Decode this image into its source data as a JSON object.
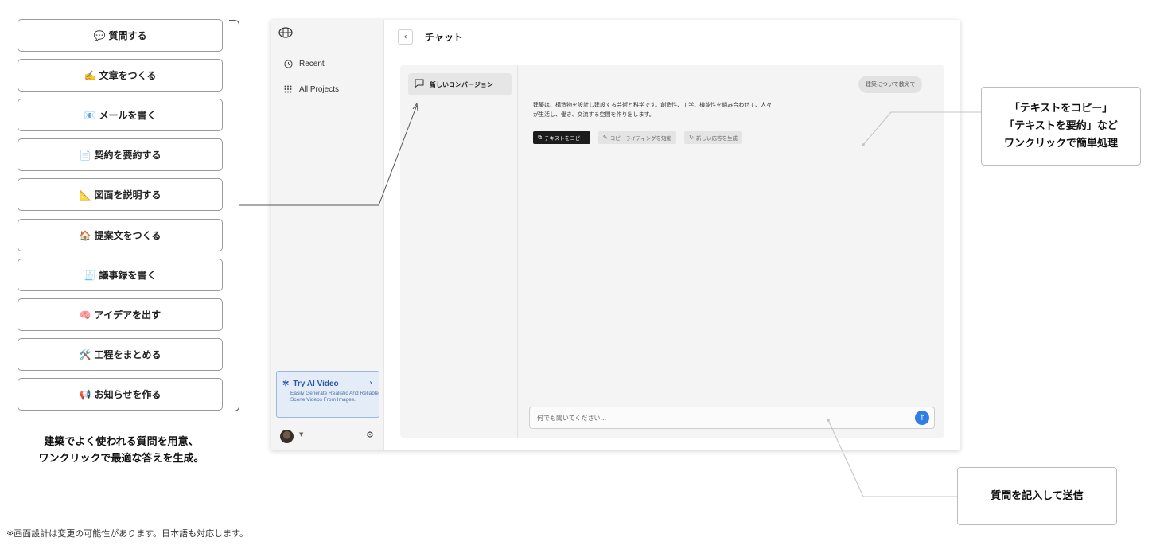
{
  "prompts": [
    {
      "emoji": "💬",
      "label": "質問する"
    },
    {
      "emoji": "✍️",
      "label": "文章をつくる"
    },
    {
      "emoji": "📧",
      "label": "メールを書く"
    },
    {
      "emoji": "📄",
      "label": "契約を要約する"
    },
    {
      "emoji": "📐",
      "label": "図面を説明する"
    },
    {
      "emoji": "🏠",
      "label": "提案文をつくる"
    },
    {
      "emoji": "🧾",
      "label": "議事録を書く"
    },
    {
      "emoji": "🧠",
      "label": "アイデアを出す"
    },
    {
      "emoji": "🛠️",
      "label": "工程をまとめる"
    },
    {
      "emoji": "📢",
      "label": "お知らせを作る"
    }
  ],
  "caption_left": {
    "line1": "建築でよく使われる質問を用意、",
    "line2": "ワンクリックで最適な答えを生成。"
  },
  "footnote": "※画面設計は変更の可能性があります。日本語も対応します。",
  "sidebar": {
    "nav": [
      {
        "icon": "clock-icon",
        "label": "Recent"
      },
      {
        "icon": "grid-icon",
        "label": "All Projects"
      }
    ],
    "promo": {
      "title": "Try AI Video",
      "description": "Easily Generate Realistic And Reliable Scene Videos From Images."
    }
  },
  "header": {
    "title": "チャット"
  },
  "conversation": {
    "label": "新しいコンバージョン"
  },
  "chat": {
    "user_message": "建築について教えて",
    "answer_line1": "建築は、構造物を設計し建設する芸術と科学です。創造性、工学、機能性を組み合わせて、人々",
    "answer_line2": "が生活し、働き、交流する空間を作り出します。",
    "actions": [
      {
        "icon": "copy-icon",
        "label": "テキストをコピー"
      },
      {
        "icon": "pencil-icon",
        "label": "コピーライティングを短縮"
      },
      {
        "icon": "refresh-icon",
        "label": "新しい応答を生成"
      }
    ],
    "input_placeholder": "何でも聞いてください..."
  },
  "callouts": {
    "right_top": {
      "line1": "「テキストをコピー」",
      "line2": "「テキストを要約」など",
      "line3": "ワンクリックで簡単処理"
    },
    "bottom": "質問を記入して送信"
  }
}
